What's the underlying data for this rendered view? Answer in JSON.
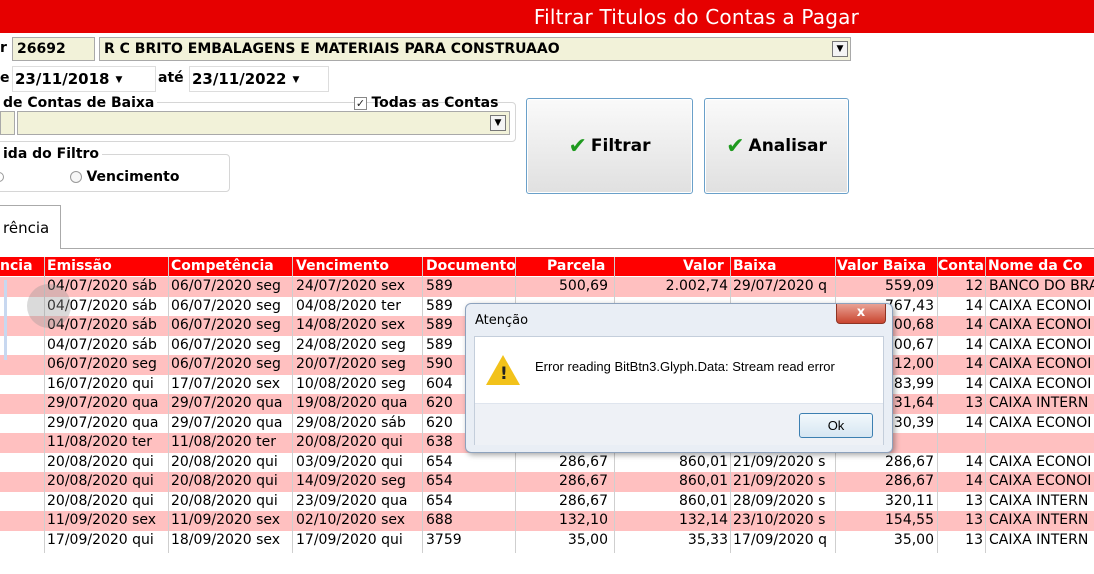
{
  "window": {
    "title": "Filtrar Titulos do Contas a Pagar"
  },
  "supplier": {
    "label": "r",
    "code": "26692",
    "name": "R C BRITO EMBALAGENS E MATERIAIS PARA CONSTRUAAO"
  },
  "period": {
    "label_from": "e",
    "date_from": "23/11/2018",
    "label_to": "até",
    "date_to": "23/11/2022"
  },
  "accounts": {
    "group_title": "de Contas de Baixa",
    "all_accounts_label": "Todas as Contas",
    "all_accounts_checked": true,
    "selected": ""
  },
  "filter_field": {
    "group_title": "ida do Filtro",
    "option_vencimento": "Vencimento"
  },
  "buttons": {
    "filtrar": "Filtrar",
    "analisar": "Analisar"
  },
  "tab": {
    "label": "rência"
  },
  "grid": {
    "headers": [
      "ncia",
      "Emissão",
      "Competência",
      "Vencimento",
      "Documento",
      "Parcela",
      "Valor",
      "Baixa",
      "Valor Baixa",
      "Conta",
      "Nome da Co"
    ],
    "rows": [
      {
        "emissao": "04/07/2020 sáb",
        "competencia": "06/07/2020 seg",
        "vencimento": "24/07/2020 sex",
        "documento": "589",
        "parcela": "500,69",
        "valor": "2.002,74",
        "baixa": "29/07/2020 q",
        "valor_baixa": "559,09",
        "conta": "12",
        "nome": "BANCO DO BRA",
        "pink": true
      },
      {
        "emissao": "04/07/2020 sáb",
        "competencia": "06/07/2020 seg",
        "vencimento": "04/08/2020 ter",
        "documento": "589",
        "parcela": "",
        "valor": "",
        "baixa": "",
        "valor_baixa": "767,43",
        "conta": "14",
        "nome": "CAIXA ECONOI",
        "pink": false
      },
      {
        "emissao": "04/07/2020 sáb",
        "competencia": "06/07/2020 seg",
        "vencimento": "14/08/2020 sex",
        "documento": "589",
        "parcela": "",
        "valor": "",
        "baixa": "",
        "valor_baixa": "00,68",
        "conta": "14",
        "nome": "CAIXA ECONOI",
        "pink": true
      },
      {
        "emissao": "04/07/2020 sáb",
        "competencia": "06/07/2020 seg",
        "vencimento": "24/08/2020 seg",
        "documento": "589",
        "parcela": "",
        "valor": "",
        "baixa": "",
        "valor_baixa": "00,67",
        "conta": "14",
        "nome": "CAIXA ECONOI",
        "pink": false
      },
      {
        "emissao": "06/07/2020 seg",
        "competencia": "06/07/2020 seg",
        "vencimento": "20/07/2020 seg",
        "documento": "590",
        "parcela": "",
        "valor": "",
        "baixa": "",
        "valor_baixa": "12,00",
        "conta": "14",
        "nome": "CAIXA ECONOI",
        "pink": true
      },
      {
        "emissao": "16/07/2020 qui",
        "competencia": "17/07/2020 sex",
        "vencimento": "10/08/2020 seg",
        "documento": "604",
        "parcela": "",
        "valor": "",
        "baixa": "",
        "valor_baixa": "83,99",
        "conta": "14",
        "nome": "CAIXA ECONOI",
        "pink": false
      },
      {
        "emissao": "29/07/2020 qua",
        "competencia": "29/07/2020 qua",
        "vencimento": "19/08/2020 qua",
        "documento": "620",
        "parcela": "",
        "valor": "",
        "baixa": "",
        "valor_baixa": "31,64",
        "conta": "13",
        "nome": "CAIXA INTERN",
        "pink": true
      },
      {
        "emissao": "29/07/2020 qua",
        "competencia": "29/07/2020 qua",
        "vencimento": "29/08/2020 sáb",
        "documento": "620",
        "parcela": "",
        "valor": "",
        "baixa": "",
        "valor_baixa": "30,39",
        "conta": "14",
        "nome": "CAIXA ECONOI",
        "pink": false
      },
      {
        "emissao": "11/08/2020 ter",
        "competencia": "11/08/2020 ter",
        "vencimento": "20/08/2020 qui",
        "documento": "638",
        "parcela": "",
        "valor": "",
        "baixa": "",
        "valor_baixa": "",
        "conta": "",
        "nome": "",
        "pink": true
      },
      {
        "emissao": "20/08/2020 qui",
        "competencia": "20/08/2020 qui",
        "vencimento": "03/09/2020 qui",
        "documento": "654",
        "parcela": "286,67",
        "valor": "860,01",
        "baixa": "21/09/2020 s",
        "valor_baixa": "286,67",
        "conta": "14",
        "nome": "CAIXA ECONOI",
        "pink": false
      },
      {
        "emissao": "20/08/2020 qui",
        "competencia": "20/08/2020 qui",
        "vencimento": "14/09/2020 seg",
        "documento": "654",
        "parcela": "286,67",
        "valor": "860,01",
        "baixa": "21/09/2020 s",
        "valor_baixa": "286,67",
        "conta": "14",
        "nome": "CAIXA ECONOI",
        "pink": true
      },
      {
        "emissao": "20/08/2020 qui",
        "competencia": "20/08/2020 qui",
        "vencimento": "23/09/2020 qua",
        "documento": "654",
        "parcela": "286,67",
        "valor": "860,01",
        "baixa": "28/09/2020 s",
        "valor_baixa": "320,11",
        "conta": "13",
        "nome": "CAIXA INTERN",
        "pink": false
      },
      {
        "emissao": "11/09/2020 sex",
        "competencia": "11/09/2020 sex",
        "vencimento": "02/10/2020 sex",
        "documento": "688",
        "parcela": "132,10",
        "valor": "132,14",
        "baixa": "23/10/2020 s",
        "valor_baixa": "154,55",
        "conta": "13",
        "nome": "CAIXA INTERN",
        "pink": true
      },
      {
        "emissao": "17/09/2020 qui",
        "competencia": "18/09/2020 sex",
        "vencimento": "17/09/2020 qui",
        "documento": "3759",
        "parcela": "35,00",
        "valor": "35,33",
        "baixa": "17/09/2020 q",
        "valor_baixa": "35,00",
        "conta": "13",
        "nome": "CAIXA INTERN",
        "pink": false
      }
    ]
  },
  "dialog": {
    "title": "Atenção",
    "close": "x",
    "warning_glyph": "!",
    "message": "Error reading BitBtn3.Glyph.Data: Stream read error",
    "ok": "Ok"
  },
  "icons": {
    "check": "check-icon",
    "warning": "warning-icon",
    "dropdown": "chevron-down-icon",
    "close": "close-icon"
  },
  "colors": {
    "titlebar": "#e60000",
    "grid_header": "#ff0000",
    "row_highlight": "#ffc0c0",
    "field_bg": "#f2f2d9"
  }
}
